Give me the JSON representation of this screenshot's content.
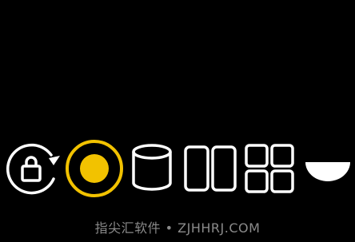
{
  "toolbar": {
    "items": [
      {
        "id": "rotate-lock",
        "icon": "rotation-lock-icon",
        "selected": false
      },
      {
        "id": "shutter",
        "icon": "shutter-button-icon",
        "selected": true
      },
      {
        "id": "panorama",
        "icon": "cylinder-panorama-icon",
        "selected": false
      },
      {
        "id": "dual",
        "icon": "dual-panel-icon",
        "selected": false
      },
      {
        "id": "grid",
        "icon": "grid-four-icon",
        "selected": false
      },
      {
        "id": "bowl",
        "icon": "bowl-icon",
        "selected": false
      }
    ]
  },
  "colors": {
    "background": "#000000",
    "icon_stroke": "#ffffff",
    "accent": "#f2c200",
    "watermark_text": "#8a8a8a"
  },
  "watermark": {
    "text": "指尖汇软件 • ZJHHRJ.COM"
  }
}
